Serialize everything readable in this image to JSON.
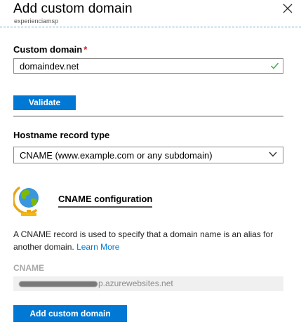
{
  "header": {
    "title": "Add custom domain",
    "subtitle": "experienciamsp"
  },
  "custom_domain": {
    "label": "Custom domain",
    "required_mark": "*",
    "value": "domaindev.net"
  },
  "validate_button": "Validate",
  "hostname_record": {
    "label": "Hostname record type",
    "selected": "CNAME (www.example.com or any subdomain)"
  },
  "cname_config": {
    "title": "CNAME configuration",
    "description": "A CNAME record is used to specify that a domain name is an alias for another domain.",
    "learn_more": "Learn More",
    "field_label": "CNAME",
    "value_visible_suffix": "p.azurewebsites.net"
  },
  "add_button": "Add custom domain",
  "colors": {
    "accent": "#0078d4",
    "success": "#3bb34a",
    "required": "#e81123"
  }
}
